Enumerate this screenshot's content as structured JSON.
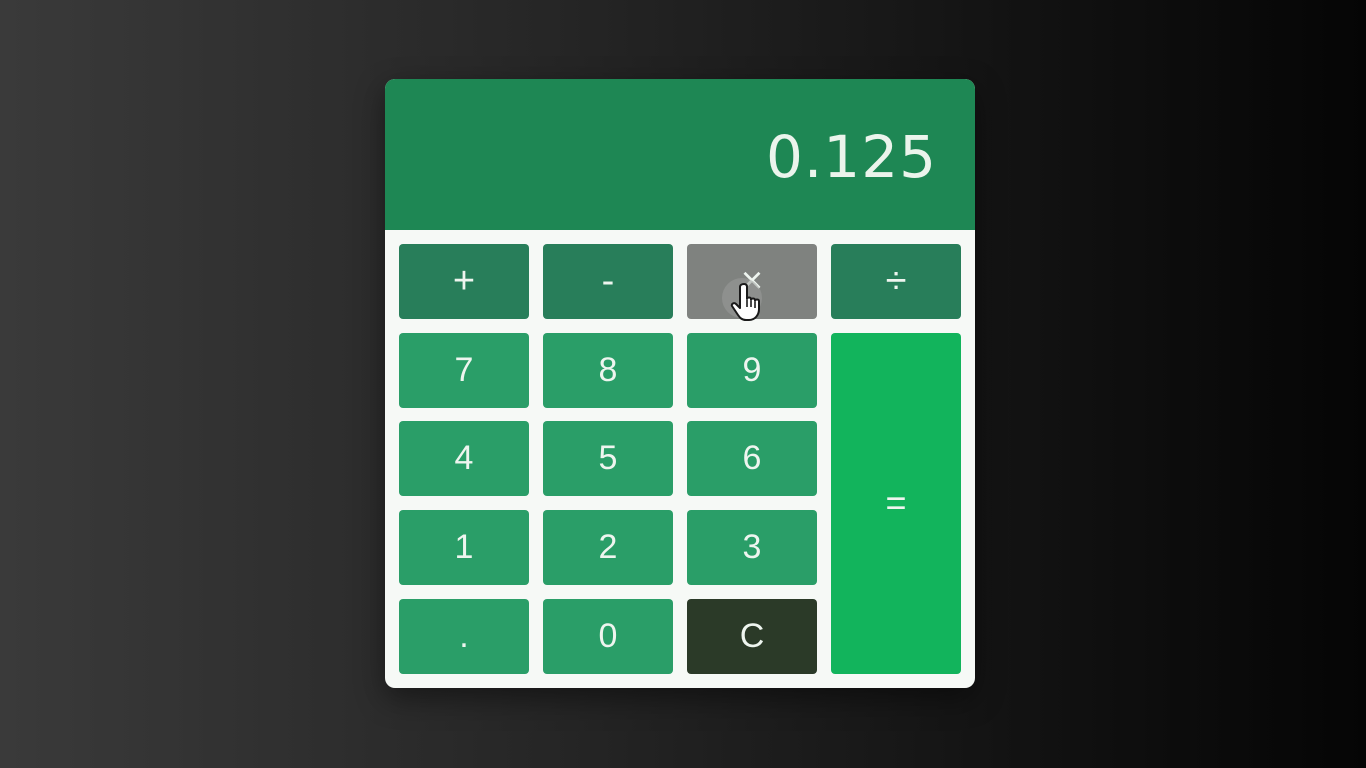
{
  "display": {
    "value": "0.125"
  },
  "operators": [
    {
      "label": "+",
      "active": false
    },
    {
      "label": "-",
      "active": false
    },
    {
      "label": "×",
      "active": true
    },
    {
      "label": "÷",
      "active": false
    }
  ],
  "keys": {
    "seven": "7",
    "eight": "8",
    "nine": "9",
    "four": "4",
    "five": "5",
    "six": "6",
    "one": "1",
    "two": "2",
    "three": "3",
    "decimal": ".",
    "zero": "0",
    "clear": "C",
    "equals": "="
  },
  "colors": {
    "display_bg": "#1e8754",
    "digit_key": "#2a9e68",
    "operator_key": "#287e5a",
    "active_key": "#7f827f",
    "equals_key": "#12b45c",
    "clear_key": "#2b3a28"
  },
  "cursor": {
    "icon": "hand-pointer-icon"
  }
}
